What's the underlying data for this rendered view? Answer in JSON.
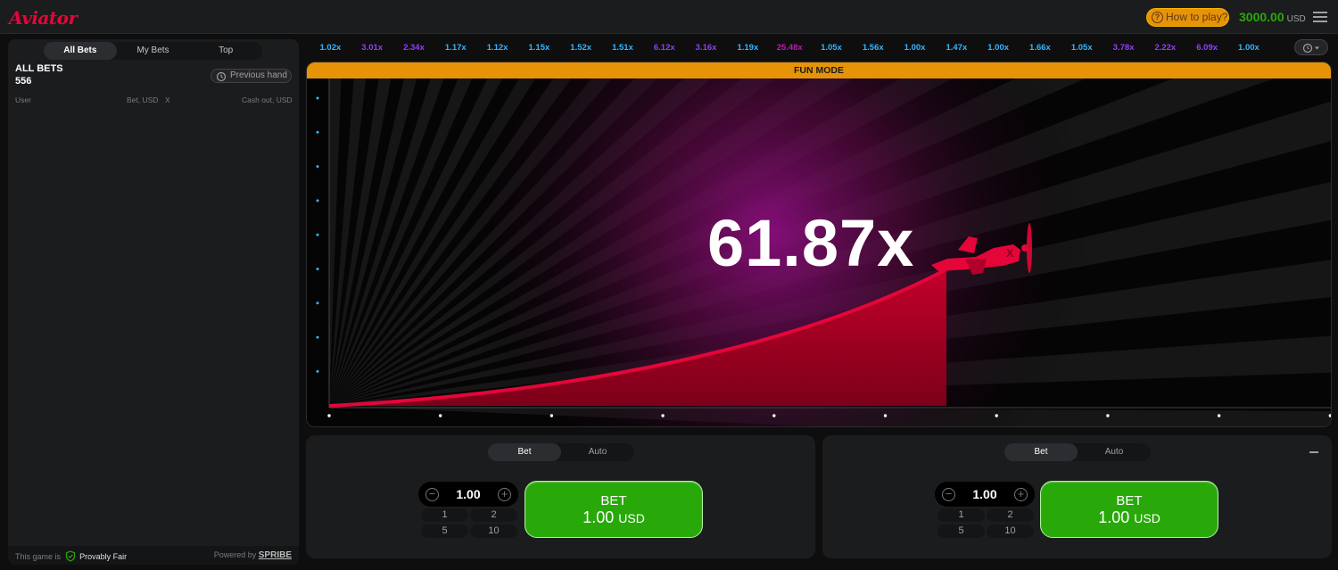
{
  "header": {
    "logo": "Aviator",
    "how_to_play": "How to play?",
    "balance": "3000.00",
    "currency": "USD"
  },
  "bets_panel": {
    "tabs": [
      "All Bets",
      "My Bets",
      "Top"
    ],
    "active_tab": "All Bets",
    "title": "ALL BETS",
    "count": "556",
    "previous_hand": "Previous hand",
    "columns": {
      "user": "User",
      "bet": "Bet, USD",
      "x": "X",
      "cashout": "Cash out, USD"
    },
    "footer": {
      "this_game_is": "This game is",
      "provably_fair": "Provably Fair",
      "powered_by": "Powered by",
      "brand": "SPRIBE"
    }
  },
  "history": [
    {
      "v": "1.02x",
      "c": "#34b4ff"
    },
    {
      "v": "3.01x",
      "c": "#913ef8"
    },
    {
      "v": "2.34x",
      "c": "#913ef8"
    },
    {
      "v": "1.17x",
      "c": "#34b4ff"
    },
    {
      "v": "1.12x",
      "c": "#34b4ff"
    },
    {
      "v": "1.15x",
      "c": "#34b4ff"
    },
    {
      "v": "1.52x",
      "c": "#34b4ff"
    },
    {
      "v": "1.51x",
      "c": "#34b4ff"
    },
    {
      "v": "6.12x",
      "c": "#913ef8"
    },
    {
      "v": "3.16x",
      "c": "#913ef8"
    },
    {
      "v": "1.19x",
      "c": "#34b4ff"
    },
    {
      "v": "25.48x",
      "c": "#c017b4"
    },
    {
      "v": "1.05x",
      "c": "#34b4ff"
    },
    {
      "v": "1.56x",
      "c": "#34b4ff"
    },
    {
      "v": "1.00x",
      "c": "#34b4ff"
    },
    {
      "v": "1.47x",
      "c": "#34b4ff"
    },
    {
      "v": "1.00x",
      "c": "#34b4ff"
    },
    {
      "v": "1.66x",
      "c": "#34b4ff"
    },
    {
      "v": "1.05x",
      "c": "#34b4ff"
    },
    {
      "v": "3.78x",
      "c": "#913ef8"
    },
    {
      "v": "2.22x",
      "c": "#913ef8"
    },
    {
      "v": "6.09x",
      "c": "#913ef8"
    },
    {
      "v": "1.00x",
      "c": "#34b4ff"
    }
  ],
  "game": {
    "mode_banner": "FUN MODE",
    "multiplier": "61.87x",
    "colors": {
      "accent": "#e50539",
      "fill": "#c2002a",
      "glow": "#7a0c6e"
    }
  },
  "bet_panels": [
    {
      "tabs": [
        "Bet",
        "Auto"
      ],
      "active": "Bet",
      "amount": "1.00",
      "quick": [
        "1",
        "2",
        "5",
        "10"
      ],
      "button_label": "BET",
      "button_amount": "1.00",
      "button_currency": "USD"
    },
    {
      "tabs": [
        "Bet",
        "Auto"
      ],
      "active": "Bet",
      "amount": "1.00",
      "quick": [
        "1",
        "2",
        "5",
        "10"
      ],
      "button_label": "BET",
      "button_amount": "1.00",
      "button_currency": "USD"
    }
  ]
}
